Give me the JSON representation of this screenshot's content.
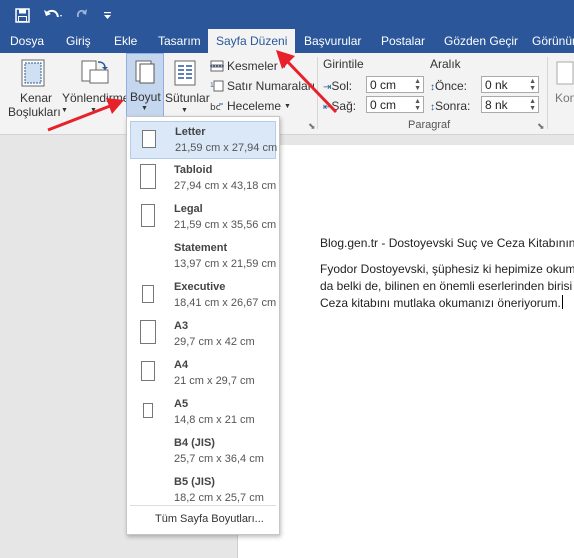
{
  "qat": {
    "save": "save-icon",
    "undo": "undo-icon",
    "redo": "redo-icon",
    "customize": "customize-qat-icon"
  },
  "tabs": [
    "Dosya",
    "Giriş",
    "Ekle",
    "Tasarım",
    "Sayfa Düzeni",
    "Başvurular",
    "Postalar",
    "Gözden Geçir",
    "Görünüm"
  ],
  "ribbon": {
    "margins": "Kenar Boşlukları",
    "margins_line1": "Kenar",
    "margins_line2": "Boşlukları",
    "orientation": "Yönlendirme",
    "size": "Boyut",
    "columns": "Sütunlar",
    "breaks": "Kesmeler",
    "line_numbers": "Satır Numaraları",
    "hyphenation": "Heceleme",
    "indent": "Girintile",
    "spacing": "Aralık",
    "left": "Sol:",
    "right": "Sağ:",
    "before": "Önce:",
    "after": "Sonra:",
    "left_val": "0 cm",
    "right_val": "0 cm",
    "before_val": "0 nk",
    "after_val": "8 nk",
    "paragraph_group": "Paragraf",
    "cut_label": "Kon"
  },
  "document": {
    "title_line": "Blog.gen.tr - Dostoyevski Suç ve Ceza Kitabının K",
    "line1": "Fyodor Dostoyevski, şüphesiz ki hepimize okuma",
    "line2": "da belki de, bilinen en önemli eserlerinden birisi",
    "line3": "Ceza kitabını mutlaka okumanızı öneriyorum."
  },
  "page_sizes": [
    {
      "name": "Letter",
      "size": "21,59 cm x 27,94 cm"
    },
    {
      "name": "Tabloid",
      "size": "27,94 cm x 43,18 cm"
    },
    {
      "name": "Legal",
      "size": "21,59 cm x 35,56 cm"
    },
    {
      "name": "Statement",
      "size": "13,97 cm x 21,59 cm"
    },
    {
      "name": "Executive",
      "size": "18,41 cm x 26,67 cm"
    },
    {
      "name": "A3",
      "size": "29,7 cm x 42 cm"
    },
    {
      "name": "A4",
      "size": "21 cm x 29,7 cm"
    },
    {
      "name": "A5",
      "size": "14,8 cm x 21 cm"
    },
    {
      "name": "B4 (JIS)",
      "size": "25,7 cm x 36,4 cm"
    },
    {
      "name": "B5 (JIS)",
      "size": "18,2 cm x 25,7 cm"
    }
  ],
  "selected_size": "Letter",
  "more_sizes": "Tüm Sayfa Boyutları...",
  "colors": {
    "brand": "#2b579a",
    "annotation_arrow": "#e8202a"
  }
}
